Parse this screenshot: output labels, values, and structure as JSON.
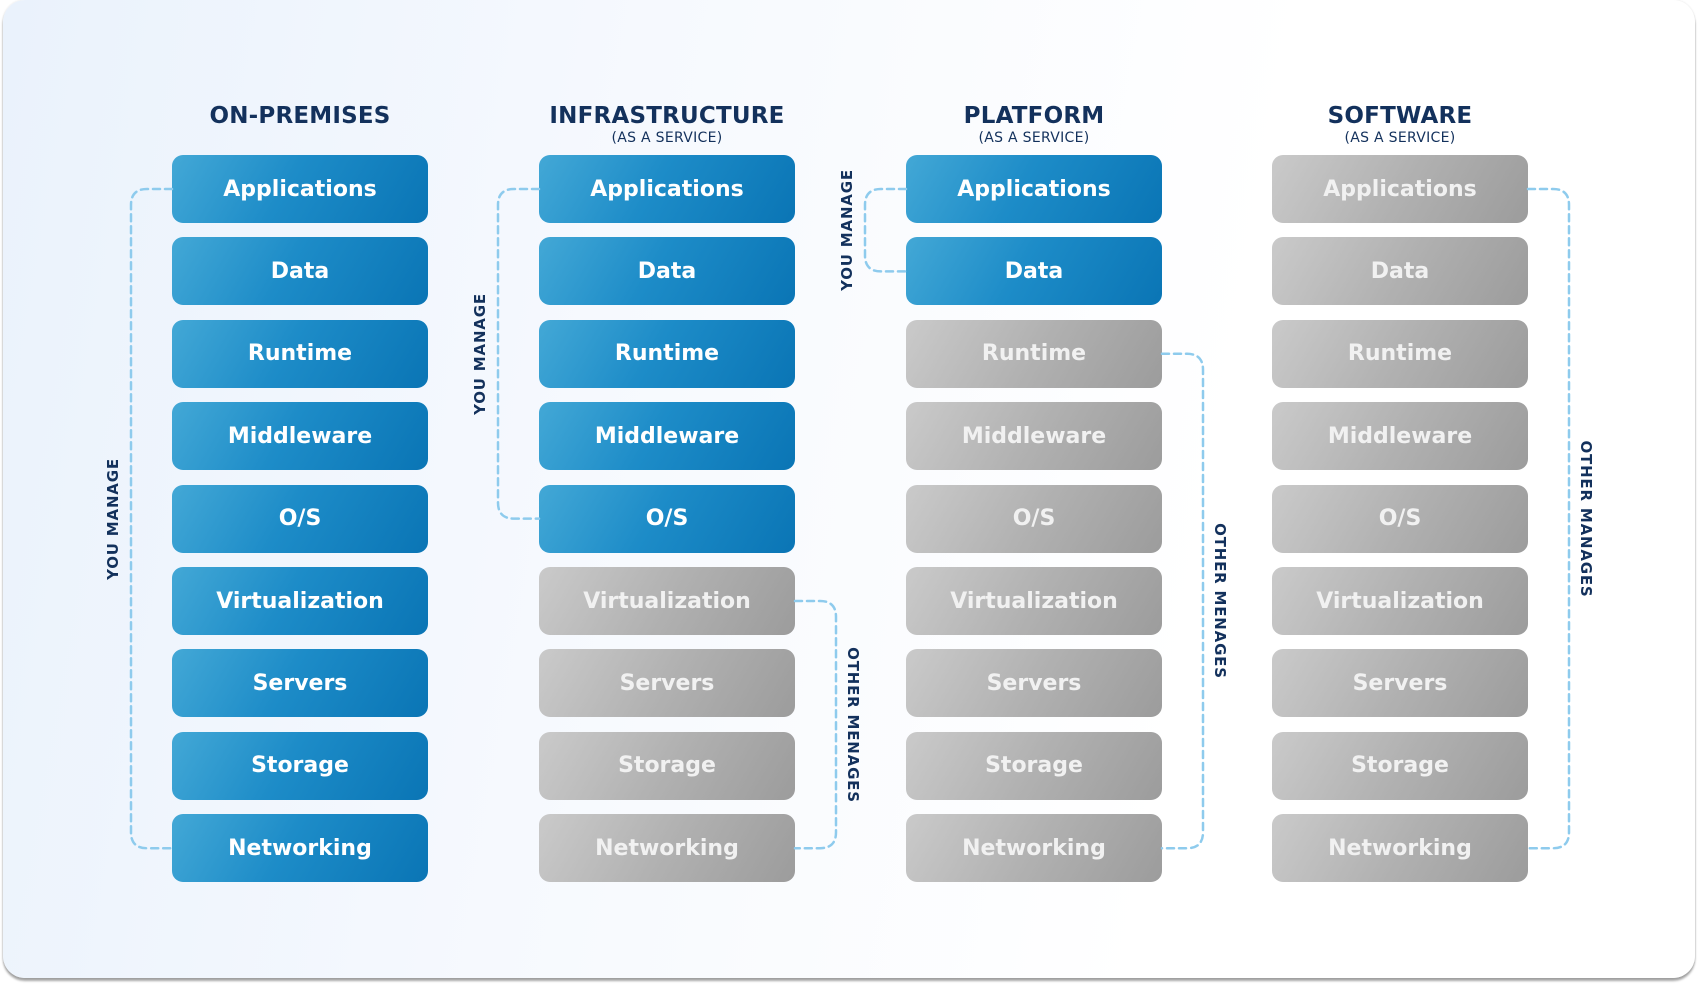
{
  "diagram": {
    "columns": [
      {
        "title": "ON-PREMISES",
        "subtitle": "",
        "layers": [
          {
            "label": "Applications",
            "managed_by": "you"
          },
          {
            "label": "Data",
            "managed_by": "you"
          },
          {
            "label": "Runtime",
            "managed_by": "you"
          },
          {
            "label": "Middleware",
            "managed_by": "you"
          },
          {
            "label": "O/S",
            "managed_by": "you"
          },
          {
            "label": "Virtualization",
            "managed_by": "you"
          },
          {
            "label": "Servers",
            "managed_by": "you"
          },
          {
            "label": "Storage",
            "managed_by": "you"
          },
          {
            "label": "Networking",
            "managed_by": "you"
          }
        ],
        "brackets": [
          {
            "label": "YOU MANAGE",
            "from": 0,
            "to": 8,
            "side": "left"
          }
        ]
      },
      {
        "title": "INFRASTRUCTURE",
        "subtitle": "(AS A SERVICE)",
        "layers": [
          {
            "label": "Applications",
            "managed_by": "you"
          },
          {
            "label": "Data",
            "managed_by": "you"
          },
          {
            "label": "Runtime",
            "managed_by": "you"
          },
          {
            "label": "Middleware",
            "managed_by": "you"
          },
          {
            "label": "O/S",
            "managed_by": "you"
          },
          {
            "label": "Virtualization",
            "managed_by": "other"
          },
          {
            "label": "Servers",
            "managed_by": "other"
          },
          {
            "label": "Storage",
            "managed_by": "other"
          },
          {
            "label": "Networking",
            "managed_by": "other"
          }
        ],
        "brackets": [
          {
            "label": "YOU MANAGE",
            "from": 0,
            "to": 4,
            "side": "left"
          },
          {
            "label": "OTHER MENAGES",
            "from": 5,
            "to": 8,
            "side": "right"
          }
        ]
      },
      {
        "title": "PLATFORM",
        "subtitle": "(AS A SERVICE)",
        "layers": [
          {
            "label": "Applications",
            "managed_by": "you"
          },
          {
            "label": "Data",
            "managed_by": "you"
          },
          {
            "label": "Runtime",
            "managed_by": "other"
          },
          {
            "label": "Middleware",
            "managed_by": "other"
          },
          {
            "label": "O/S",
            "managed_by": "other"
          },
          {
            "label": "Virtualization",
            "managed_by": "other"
          },
          {
            "label": "Servers",
            "managed_by": "other"
          },
          {
            "label": "Storage",
            "managed_by": "other"
          },
          {
            "label": "Networking",
            "managed_by": "other"
          }
        ],
        "brackets": [
          {
            "label": "YOU MANAGE",
            "from": 0,
            "to": 1,
            "side": "left"
          },
          {
            "label": "OTHER MENAGES",
            "from": 2,
            "to": 8,
            "side": "right"
          }
        ]
      },
      {
        "title": "SOFTWARE",
        "subtitle": "(AS A SERVICE)",
        "layers": [
          {
            "label": "Applications",
            "managed_by": "other"
          },
          {
            "label": "Data",
            "managed_by": "other"
          },
          {
            "label": "Runtime",
            "managed_by": "other"
          },
          {
            "label": "Middleware",
            "managed_by": "other"
          },
          {
            "label": "O/S",
            "managed_by": "other"
          },
          {
            "label": "Virtualization",
            "managed_by": "other"
          },
          {
            "label": "Servers",
            "managed_by": "other"
          },
          {
            "label": "Storage",
            "managed_by": "other"
          },
          {
            "label": "Networking",
            "managed_by": "other"
          }
        ],
        "brackets": [
          {
            "label": "OTHER MANAGES",
            "from": 0,
            "to": 8,
            "side": "right"
          }
        ]
      }
    ],
    "colors": {
      "you_manage": "#1a8ac6",
      "other_manages": "#b3b3b3",
      "bracket": "#8ecbed",
      "heading": "#13315c"
    }
  }
}
